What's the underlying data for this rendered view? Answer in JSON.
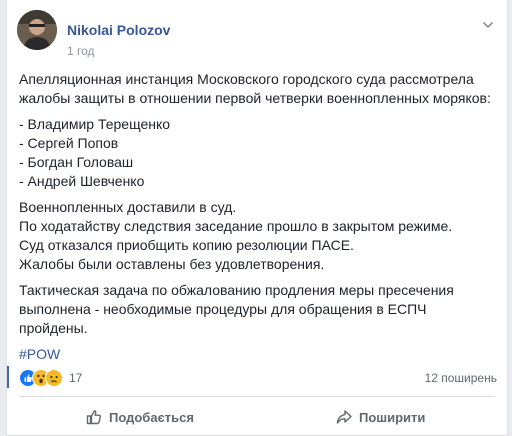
{
  "post": {
    "author": "Nikolai Polozov",
    "timestamp": "1 год",
    "paragraphs": [
      [
        "Апелляционная инстанция Московского городского суда рассмотрела",
        "жалобы защиты в отношении первой четверки военнопленных моряков:"
      ],
      [
        "- Владимир Терещенко",
        "- Сергей Попов",
        "- Богдан Головаш",
        "- Андрей Шевченко"
      ],
      [
        "Военнопленных доставили в суд.",
        "По ходатайству следствия заседание прошло в закрытом режиме.",
        "Суд отказался приобщить копию резолюции ПАСЕ.",
        "Жалобы были оставлены без удовлетворения."
      ],
      [
        "Тактическая задача по обжалованию продления меры пресечения",
        "выполнена - необходимые процедуры для обращения в ЕСПЧ",
        "пройдены."
      ]
    ],
    "hashtag": "#POW"
  },
  "stats": {
    "reactions": [
      "like-icon",
      "wow-icon",
      "sad-icon"
    ],
    "reaction_count": "17",
    "shares": "12 поширень"
  },
  "actions": {
    "like_label": "Подобається",
    "share_label": "Поширити"
  },
  "colors": {
    "link": "#365899",
    "text": "#1d2129",
    "muted": "#90949c",
    "accent": "#4267b2"
  }
}
